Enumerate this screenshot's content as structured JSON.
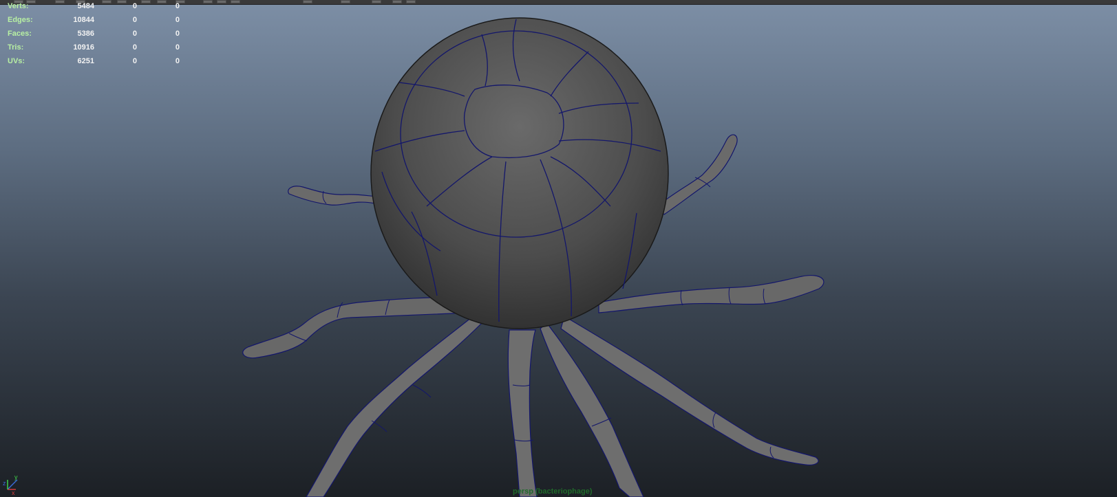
{
  "hud": {
    "rows": [
      {
        "label": "Verts:",
        "v1": "5484",
        "v2": "0",
        "v3": "0"
      },
      {
        "label": "Edges:",
        "v1": "10844",
        "v2": "0",
        "v3": "0"
      },
      {
        "label": "Faces:",
        "v1": "5386",
        "v2": "0",
        "v3": "0"
      },
      {
        "label": "Tris:",
        "v1": "10916",
        "v2": "0",
        "v3": "0"
      },
      {
        "label": "UVs:",
        "v1": "6251",
        "v2": "0",
        "v3": "0"
      }
    ]
  },
  "viewport": {
    "camera_label": "persp (bacteriophage)",
    "axis_labels": {
      "x": "x",
      "y": "y",
      "z": "z"
    }
  },
  "colors": {
    "wireframe": "#13166b",
    "mesh": "#4a4a4a",
    "hud_label": "#b8f0a3"
  }
}
